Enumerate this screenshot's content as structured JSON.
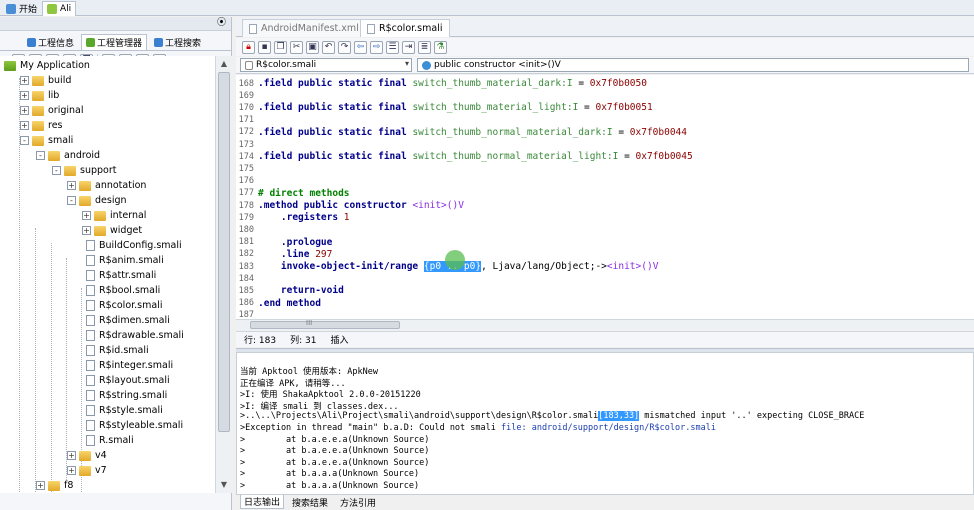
{
  "app_tabs": [
    {
      "label": "开始",
      "icon": "home-icon"
    },
    {
      "label": "Ali",
      "icon": "android-icon"
    }
  ],
  "left_panel": {
    "tabs": [
      {
        "label": "工程信息",
        "icon": "info-icon"
      },
      {
        "label": "工程管理器",
        "icon": "project-icon"
      },
      {
        "label": "工程搜索",
        "icon": "search-icon"
      }
    ],
    "toolbar_icons": [
      "refresh-icon",
      "list-icon",
      "stop-icon",
      "folder-open-icon",
      "copy-icon",
      "delete-icon",
      "split-icon",
      "paste-icon",
      "add-icon"
    ],
    "tree": [
      {
        "label": "My Application",
        "level": 0,
        "kind": "root",
        "exp": "none"
      },
      {
        "label": "build",
        "level": 1,
        "kind": "folder",
        "exp": "+"
      },
      {
        "label": "lib",
        "level": 1,
        "kind": "folder",
        "exp": "+"
      },
      {
        "label": "original",
        "level": 1,
        "kind": "folder",
        "exp": "+"
      },
      {
        "label": "res",
        "level": 1,
        "kind": "folder",
        "exp": "+"
      },
      {
        "label": "smali",
        "level": 1,
        "kind": "folder",
        "exp": "-"
      },
      {
        "label": "android",
        "level": 2,
        "kind": "folder",
        "exp": "-"
      },
      {
        "label": "support",
        "level": 3,
        "kind": "folder",
        "exp": "-"
      },
      {
        "label": "annotation",
        "level": 4,
        "kind": "folder",
        "exp": "+"
      },
      {
        "label": "design",
        "level": 4,
        "kind": "folder",
        "exp": "-"
      },
      {
        "label": "internal",
        "level": 5,
        "kind": "folder",
        "exp": "+"
      },
      {
        "label": "widget",
        "level": 5,
        "kind": "folder",
        "exp": "+"
      },
      {
        "label": "BuildConfig.smali",
        "level": 5,
        "kind": "file",
        "exp": "none"
      },
      {
        "label": "R$anim.smali",
        "level": 5,
        "kind": "file",
        "exp": "none"
      },
      {
        "label": "R$attr.smali",
        "level": 5,
        "kind": "file",
        "exp": "none"
      },
      {
        "label": "R$bool.smali",
        "level": 5,
        "kind": "file",
        "exp": "none"
      },
      {
        "label": "R$color.smali",
        "level": 5,
        "kind": "file",
        "exp": "none"
      },
      {
        "label": "R$dimen.smali",
        "level": 5,
        "kind": "file",
        "exp": "none"
      },
      {
        "label": "R$drawable.smali",
        "level": 5,
        "kind": "file",
        "exp": "none"
      },
      {
        "label": "R$id.smali",
        "level": 5,
        "kind": "file",
        "exp": "none"
      },
      {
        "label": "R$integer.smali",
        "level": 5,
        "kind": "file",
        "exp": "none"
      },
      {
        "label": "R$layout.smali",
        "level": 5,
        "kind": "file",
        "exp": "none"
      },
      {
        "label": "R$string.smali",
        "level": 5,
        "kind": "file",
        "exp": "none"
      },
      {
        "label": "R$style.smali",
        "level": 5,
        "kind": "file",
        "exp": "none"
      },
      {
        "label": "R$styleable.smali",
        "level": 5,
        "kind": "file",
        "exp": "none"
      },
      {
        "label": "R.smali",
        "level": 5,
        "kind": "file",
        "exp": "none"
      },
      {
        "label": "v4",
        "level": 4,
        "kind": "folder",
        "exp": "+"
      },
      {
        "label": "v7",
        "level": 4,
        "kind": "folder",
        "exp": "+"
      },
      {
        "label": "f8",
        "level": 2,
        "kind": "folder",
        "exp": "+"
      }
    ]
  },
  "editor": {
    "tabs": [
      {
        "label": "AndroidManifest.xml",
        "active": false
      },
      {
        "label": "R$color.smali",
        "active": true
      }
    ],
    "toolbar_icons": [
      "lock-icon",
      "save-icon",
      "copy-icon",
      "cut-icon",
      "paste-icon",
      "undo-icon",
      "redo-icon",
      "back-icon",
      "forward-icon",
      "format-icon",
      "indent-icon",
      "comment-icon",
      "build-icon"
    ],
    "file_combo": "R$color.smali",
    "member_combo": "public constructor <init>()V",
    "lines": [
      {
        "n": "168",
        "parts": [
          [
            ".field public static final ",
            "kw"
          ],
          [
            "switch_thumb_material_dark:I",
            "gr"
          ],
          [
            " = ",
            ""
          ],
          [
            "0x7f0b0050",
            "hx"
          ]
        ]
      },
      {
        "n": "169",
        "parts": []
      },
      {
        "n": "170",
        "parts": [
          [
            ".field public static final ",
            "kw"
          ],
          [
            "switch_thumb_material_light:I",
            "gr"
          ],
          [
            " = ",
            ""
          ],
          [
            "0x7f0b0051",
            "hx"
          ]
        ]
      },
      {
        "n": "171",
        "parts": []
      },
      {
        "n": "172",
        "parts": [
          [
            ".field public static final ",
            "kw"
          ],
          [
            "switch_thumb_normal_material_dark:I",
            "gr"
          ],
          [
            " = ",
            ""
          ],
          [
            "0x7f0b0044",
            "hx"
          ]
        ]
      },
      {
        "n": "173",
        "parts": []
      },
      {
        "n": "174",
        "parts": [
          [
            ".field public static final ",
            "kw"
          ],
          [
            "switch_thumb_normal_material_light:I",
            "gr"
          ],
          [
            " = ",
            ""
          ],
          [
            "0x7f0b0045",
            "hx"
          ]
        ]
      },
      {
        "n": "175",
        "parts": []
      },
      {
        "n": "176",
        "parts": []
      },
      {
        "n": "177",
        "parts": [
          [
            "# direct methods",
            "cm"
          ]
        ]
      },
      {
        "n": "178",
        "parts": [
          [
            ".method public constructor ",
            "kw"
          ],
          [
            "<init>",
            "pl"
          ],
          [
            "()V",
            "pl"
          ]
        ]
      },
      {
        "n": "179",
        "parts": [
          [
            "    .registers ",
            "kw"
          ],
          [
            "1",
            "hx"
          ]
        ]
      },
      {
        "n": "180",
        "parts": []
      },
      {
        "n": "181",
        "parts": [
          [
            "    .prologue",
            "kw"
          ]
        ]
      },
      {
        "n": "182",
        "parts": [
          [
            "    .line ",
            "kw"
          ],
          [
            "297",
            "hx"
          ]
        ]
      },
      {
        "n": "183",
        "parts": [
          [
            "    invoke-object-init/range ",
            "kw"
          ],
          [
            "{p0 .. p0}",
            "sel"
          ],
          [
            ", Ljava/lang/Object;->",
            ""
          ],
          [
            "<init>",
            "pl"
          ],
          [
            "()V",
            "pl"
          ]
        ]
      },
      {
        "n": "184",
        "parts": []
      },
      {
        "n": "185",
        "parts": [
          [
            "    return-void",
            "kw"
          ]
        ]
      },
      {
        "n": "186",
        "parts": [
          [
            ".end method",
            "kw"
          ]
        ]
      },
      {
        "n": "187",
        "parts": []
      }
    ],
    "hscroll_grip": "III",
    "status": {
      "row": "行: 183",
      "col": "列: 31",
      "mode": "插入"
    }
  },
  "log": {
    "lines": [
      {
        "parts": [
          [
            "当前 Apktool 使用版本: ApkNew",
            ""
          ]
        ]
      },
      {
        "parts": [
          [
            "正在编译 APK, 请稍等...",
            ""
          ]
        ]
      },
      {
        "parts": [
          [
            ">I: 使用 ShakaApktool 2.0.0-20151220",
            ""
          ]
        ]
      },
      {
        "parts": [
          [
            ">I: 编译 smali 到 classes.dex...",
            ""
          ]
        ]
      },
      {
        "parts": [
          [
            ">..\\..\\Projects\\Ali\\Project\\smali\\android\\support\\design\\R$color.smali",
            ""
          ],
          [
            "[183,33]",
            "hl"
          ],
          [
            " mismatched input '..' expecting CLOSE_BRACE",
            ""
          ]
        ]
      },
      {
        "parts": [
          [
            ">Exception in thread \"main\" b.a.D: Could not smali ",
            ""
          ],
          [
            "file: android/support/design/R$color.smali",
            "lnk"
          ]
        ]
      },
      {
        "parts": [
          [
            ">        at b.a.e.e.a(Unknown Source)",
            ""
          ]
        ]
      },
      {
        "parts": [
          [
            ">        at b.a.e.e.a(Unknown Source)",
            ""
          ]
        ]
      },
      {
        "parts": [
          [
            ">        at b.a.e.e.a(Unknown Source)",
            ""
          ]
        ]
      },
      {
        "parts": [
          [
            ">        at b.a.a.a(Unknown Source)",
            ""
          ]
        ]
      },
      {
        "parts": [
          [
            ">        at b.a.a.a(Unknown Source)",
            ""
          ]
        ]
      }
    ],
    "tabs": [
      {
        "label": "日志输出",
        "active": true
      },
      {
        "label": "搜索结果",
        "active": false
      },
      {
        "label": "方法引用",
        "active": false
      }
    ]
  },
  "colors": {
    "selection": "#3399ff",
    "keyword": "#00008b",
    "field_name": "#3a8a3a",
    "hex": "#8b0000",
    "comment": "#008000"
  }
}
